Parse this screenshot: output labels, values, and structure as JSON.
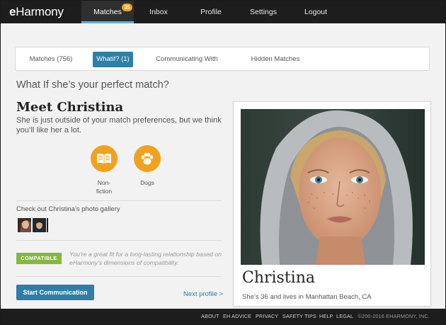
{
  "app": {
    "logo_prefix": "e",
    "logo_rest": "Harmony"
  },
  "nav": {
    "items": [
      {
        "label": "Matches",
        "badge": "35",
        "active": true
      },
      {
        "label": "Inbox"
      },
      {
        "label": "Profile"
      },
      {
        "label": "Settings"
      },
      {
        "label": "Logout"
      }
    ]
  },
  "tabs": [
    {
      "label": "Matches (756)"
    },
    {
      "label": "Whatif? (1)",
      "active": true
    },
    {
      "label": "Communicating With"
    },
    {
      "label": "Hidden Matches"
    }
  ],
  "main": {
    "heading": "What If she’s your perfect match?",
    "meet_title": "Meet Christina",
    "meet_desc": "She is just outside of your match preferences, but we think you’ll like her a lot.",
    "interests": [
      {
        "icon": "book-icon",
        "label": "Non-fiction"
      },
      {
        "icon": "paw-icon",
        "label": "Dogs"
      }
    ],
    "gallery_title": "Check out Christina’s photo gallery",
    "compat_badge": "COMPATIBLE",
    "compat_text": "You’re a great fit for a long-lasting relationship based on eHarmony’s dimensions of compatibility.",
    "start_button": "Start Communication",
    "next_link": "Next profile >"
  },
  "profile": {
    "name": "Christina",
    "subline": "She’s 36 and lives in Manhattan Beach, CA"
  },
  "footer": {
    "links": [
      "ABOUT",
      "EH ADVICE",
      "PRIVACY",
      "SAFETY TIPS",
      "HELP",
      "LEGAL"
    ],
    "copyright": "©200-2016 EHARMONY, INC."
  },
  "colors": {
    "nav_bg": "#1d1d1d",
    "accent_blue": "#2e7ea7",
    "nav_underline": "#5bb1d8",
    "interest_orange": "#f0a21e",
    "badge_orange": "#f39c12",
    "compatible_green": "#86b840"
  }
}
